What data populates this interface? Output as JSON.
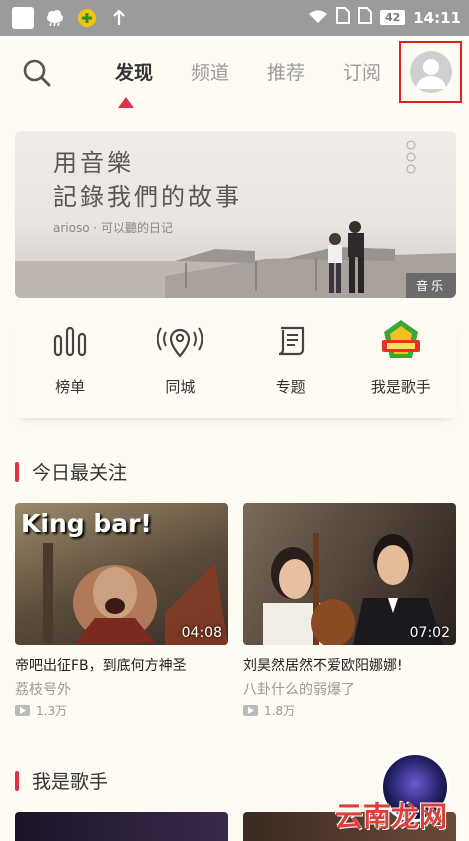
{
  "status_bar": {
    "battery": "42",
    "time": "14:11"
  },
  "nav": {
    "tabs": [
      {
        "label": "发现",
        "active": true
      },
      {
        "label": "频道",
        "active": false
      },
      {
        "label": "推荐",
        "active": false
      },
      {
        "label": "订阅",
        "active": false
      }
    ]
  },
  "banner": {
    "line1": "用音樂",
    "line2": "記錄我們的故事",
    "subtitle": "arioso · 可以聽的日记",
    "tag": "音乐"
  },
  "entries": [
    {
      "label": "榜单",
      "icon": "chart-bars-icon"
    },
    {
      "label": "同城",
      "icon": "location-pin-icon"
    },
    {
      "label": "专题",
      "icon": "scroll-icon"
    },
    {
      "label": "我是歌手",
      "icon": "singer-show-logo-icon"
    }
  ],
  "sections": [
    {
      "title": "今日最关注",
      "videos": [
        {
          "title": "帝吧出征FB，到底何方神圣",
          "author": "荔枝号外",
          "views": "1.3万",
          "duration": "04:08",
          "thumb_caption": "King bar!"
        },
        {
          "title": "刘昊然居然不爱欧阳娜娜!",
          "author": "八卦什么的弱爆了",
          "views": "1.8万",
          "duration": "07:02"
        }
      ]
    },
    {
      "title": "我是歌手"
    }
  ],
  "watermark": "云南龙网",
  "colors": {
    "accent": "#e0304a",
    "background": "#fdfbf2",
    "status_bar": "#9b9b9b"
  }
}
